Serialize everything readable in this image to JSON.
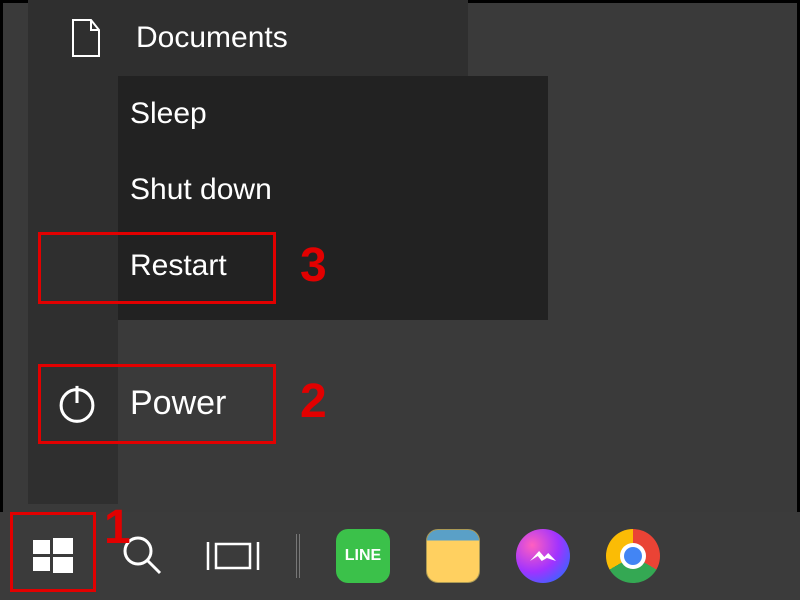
{
  "sidebar": {
    "documents_label": "Documents"
  },
  "power_menu": {
    "sleep_label": "Sleep",
    "shutdown_label": "Shut down",
    "restart_label": "Restart"
  },
  "power_button_label": "Power",
  "taskbar": {
    "line_badge": "LINE"
  },
  "annotations": {
    "n1": "1",
    "n2": "2",
    "n3": "3"
  }
}
